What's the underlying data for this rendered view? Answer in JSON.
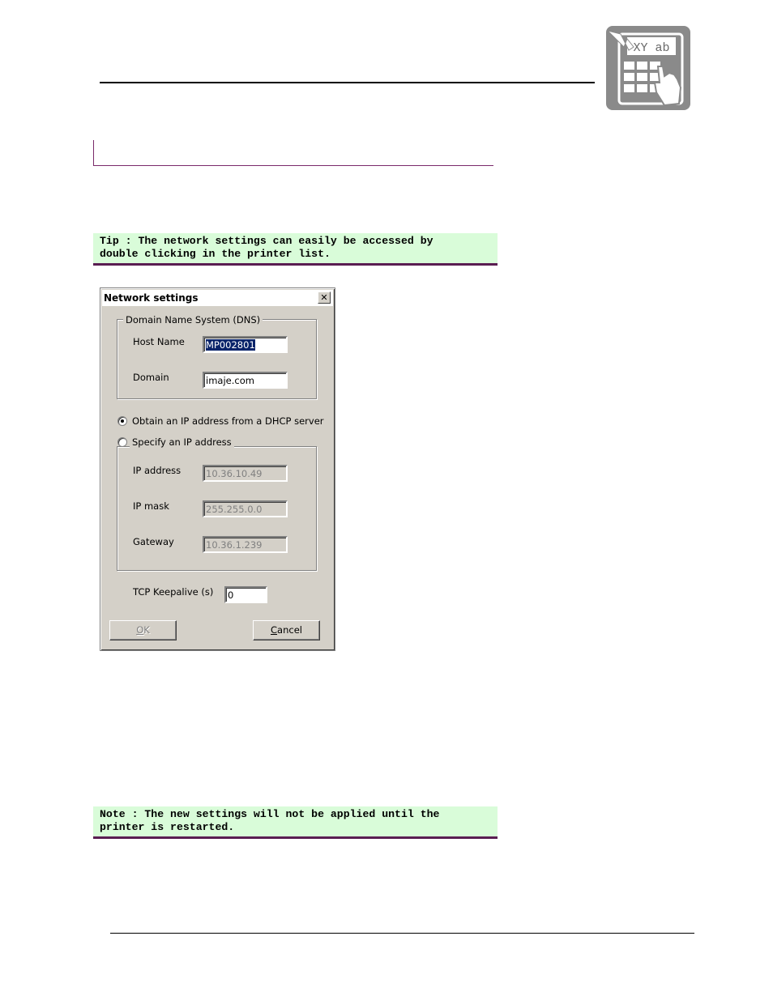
{
  "callouts": {
    "tip": "Tip : The network settings can easily be accessed by\ndouble clicking in the printer list.",
    "note": "Note : The new settings will not be applied until the\nprinter is restarted."
  },
  "logo": {
    "text": "XY ab"
  },
  "dialog": {
    "title": "Network settings",
    "close_glyph": "✕",
    "dns_group": {
      "label": "Domain Name System (DNS)",
      "host_name_label": "Host Name",
      "host_name_value": "MP002801",
      "domain_label": "Domain",
      "domain_value": "imaje.com"
    },
    "radio_dhcp": {
      "label": "Obtain an IP address from a DHCP server",
      "selected": true
    },
    "radio_static": {
      "label": "Specify an IP address",
      "selected": false
    },
    "ip_group": {
      "ip_address_label": "IP address",
      "ip_address_value": "10.36.10.49",
      "ip_mask_label": "IP mask",
      "ip_mask_value": "255.255.0.0",
      "gateway_label": "Gateway",
      "gateway_value": "10.36.1.239"
    },
    "keepalive": {
      "label": "TCP Keepalive (s)",
      "value": "0"
    },
    "ok_button": {
      "label_char": "O",
      "label_rest": "K",
      "enabled": false
    },
    "cancel_button": {
      "label_char": "C",
      "label_rest": "ancel"
    }
  },
  "colors": {
    "callout_bg": "#d9fcd9",
    "callout_border": "#5a1d52",
    "dialog_face": "#d4d0c8",
    "selection": "#0a246a"
  }
}
